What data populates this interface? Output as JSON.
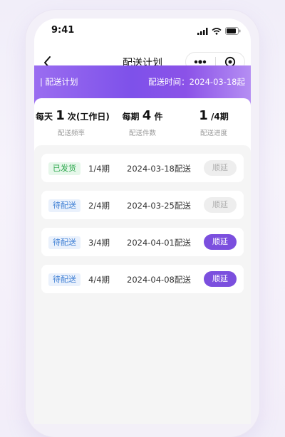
{
  "status_bar": {
    "time": "9:41"
  },
  "nav": {
    "title": "配送计划"
  },
  "banner": {
    "label": "| 配送计划",
    "date": "配送时间：2024-03-18起"
  },
  "stats": [
    {
      "prefix": "每天",
      "value": "1",
      "suffix": "次(工作日)",
      "caption": "配送频率"
    },
    {
      "prefix": "每期",
      "value": "4",
      "suffix": "件",
      "caption": "配送件数"
    },
    {
      "prefix": "",
      "value": "1",
      "suffix": "/4期",
      "caption": "配送进度"
    }
  ],
  "deliveries": [
    {
      "status": "已发货",
      "status_color": "#2fa84f",
      "period": "1/4期",
      "date": "2024-03-18配送",
      "action": "顺延",
      "action_enabled": false
    },
    {
      "status": "待配送",
      "status_color": "#3e7fd4",
      "period": "2/4期",
      "date": "2024-03-25配送",
      "action": "顺延",
      "action_enabled": false
    },
    {
      "status": "待配送",
      "status_color": "#3e7fd4",
      "period": "3/4期",
      "date": "2024-04-01配送",
      "action": "顺延",
      "action_enabled": true
    },
    {
      "status": "待配送",
      "status_color": "#3e7fd4",
      "period": "4/4期",
      "date": "2024-04-08配送",
      "action": "顺延",
      "action_enabled": true
    }
  ],
  "colors": {
    "accent": "#7b4fde",
    "banner_start": "#9a6df0",
    "banner_end": "#b58ef3"
  }
}
